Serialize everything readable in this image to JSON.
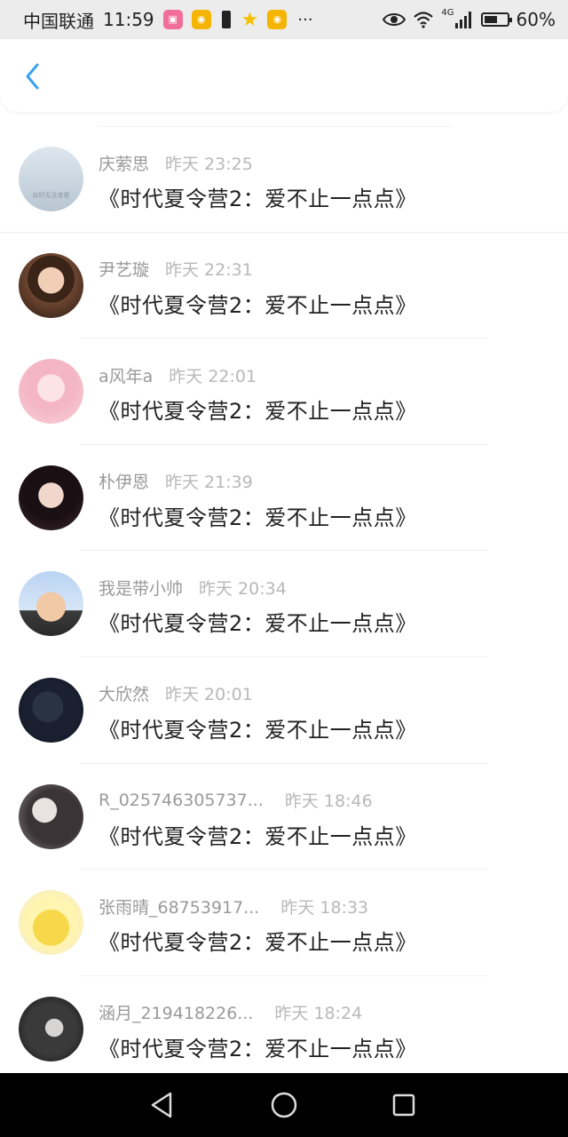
{
  "status_bar": {
    "carrier": "中国联通",
    "time": "11:59",
    "more": "···",
    "network": "4G",
    "battery_percent": "60%",
    "battery_level": 0.6
  },
  "header": {
    "back_icon": "chevron-left-icon",
    "accent_color": "#3aa0ee"
  },
  "comments": [
    {
      "name": "庆萦思",
      "time": "昨天 23:25",
      "title": "《时代夏令营2：爱不止一点点》",
      "avatar_caption": "如时无法查看"
    },
    {
      "name": "尹艺璇",
      "time": "昨天 22:31",
      "title": "《时代夏令营2：爱不止一点点》"
    },
    {
      "name": "a风年a",
      "time": "昨天 22:01",
      "title": "《时代夏令营2：爱不止一点点》"
    },
    {
      "name": "朴伊恩",
      "time": "昨天 21:39",
      "title": "《时代夏令营2：爱不止一点点》"
    },
    {
      "name": "我是带小帅",
      "time": "昨天 20:34",
      "title": "《时代夏令营2：爱不止一点点》"
    },
    {
      "name": "大欣然",
      "time": "昨天 20:01",
      "title": "《时代夏令营2：爱不止一点点》"
    },
    {
      "name": "R_025746305737...",
      "time": "昨天 18:46",
      "title": "《时代夏令营2：爱不止一点点》"
    },
    {
      "name": "张雨晴_68753917...",
      "time": "昨天 18:33",
      "title": "《时代夏令营2：爱不止一点点》"
    },
    {
      "name": "涵月_219418226...",
      "time": "昨天 18:24",
      "title": "《时代夏令营2：爱不止一点点》"
    }
  ],
  "nav_bar": {
    "back_icon": "triangle-back-icon",
    "home_icon": "circle-home-icon",
    "recents_icon": "square-recents-icon"
  }
}
